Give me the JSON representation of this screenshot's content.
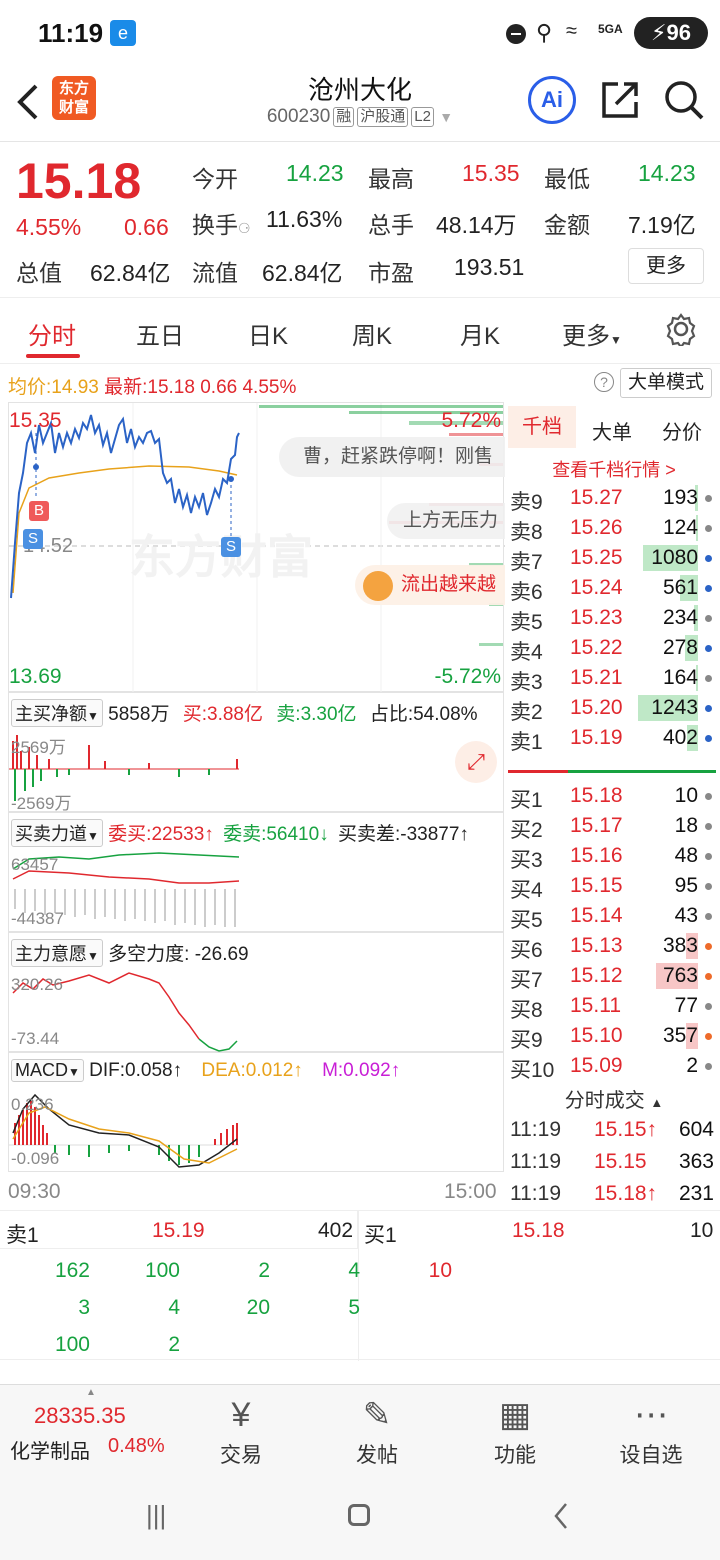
{
  "status": {
    "time": "11:19",
    "battery": "96",
    "network": "5GA"
  },
  "header": {
    "logo": "东方\n财富",
    "name": "沧州大化",
    "code": "600230",
    "tags": [
      "融",
      "沪股通",
      "L2"
    ]
  },
  "quote": {
    "price": "15.18",
    "pct": "4.55%",
    "chg": "0.66",
    "fields": [
      {
        "label": "今开",
        "value": "14.23",
        "c": "green"
      },
      {
        "label": "最高",
        "value": "15.35",
        "c": "red"
      },
      {
        "label": "最低",
        "value": "14.23",
        "c": "green"
      },
      {
        "label": "换手",
        "value": "11.63%",
        "c": "dark"
      },
      {
        "label": "总手",
        "value": "48.14万",
        "c": "dark"
      },
      {
        "label": "金额",
        "value": "7.19亿",
        "c": "dark"
      },
      {
        "label": "总值",
        "value": "62.84亿",
        "c": "dark"
      },
      {
        "label": "流值",
        "value": "62.84亿",
        "c": "dark"
      },
      {
        "label": "市盈",
        "value": "193.51",
        "c": "dark"
      }
    ],
    "more": "更多"
  },
  "tabs": [
    "分时",
    "五日",
    "日K",
    "周K",
    "月K",
    "更多"
  ],
  "avgbar": {
    "avg_label": "均价:",
    "avg": "14.93",
    "last_label": "最新:",
    "last": "15.18",
    "chg": "0.66",
    "pct": "4.55%",
    "mode": "大单模式"
  },
  "chart": {
    "high": "15.35",
    "mid": "14.52",
    "low": "13.69",
    "pct_high": "5.72%",
    "pct_low": "-5.72%",
    "time_start": "09:30",
    "time_end": "15:00",
    "watermark": "东方财富",
    "bubble1": "曹，赶紧跌停啊！刚售",
    "bubble2": "上方无压力",
    "bubble3": "流出越来越",
    "b_mark": "B",
    "s_mark": "S"
  },
  "sub1": {
    "label": "主买净额",
    "net": "5858万",
    "buy_label": "买:",
    "buy": "3.88亿",
    "sell_label": "卖:",
    "sell": "3.30亿",
    "ratio_label": "占比:",
    "ratio": "54.08%",
    "top": "2569万",
    "bot": "-2569万"
  },
  "sub2": {
    "label": "买卖力道",
    "wb_label": "委买:",
    "wb": "22533↑",
    "ws_label": "委卖:",
    "ws": "56410↓",
    "diff_label": "买卖差:",
    "diff": "-33877↑",
    "top": "63457",
    "bot": "-44387"
  },
  "sub3": {
    "label": "主力意愿",
    "force": "多空力度: -26.69",
    "top": "320.26",
    "bot": "-73.44"
  },
  "sub4": {
    "label": "MACD",
    "dif": "DIF:0.058↑",
    "dea": "DEA:0.012↑",
    "m": "M:0.092↑",
    "top": "0.236",
    "bot": "-0.096"
  },
  "book": {
    "tabs": [
      "千档",
      "大单",
      "分价"
    ],
    "link": "查看千档行情 >",
    "asks": [
      {
        "l": "卖9",
        "p": "15.27",
        "v": "193",
        "w": 0.05,
        "dot": "gray"
      },
      {
        "l": "卖8",
        "p": "15.26",
        "v": "124",
        "w": 0.03,
        "dot": "gray"
      },
      {
        "l": "卖7",
        "p": "15.25",
        "v": "1080",
        "w": 0.92,
        "dot": "blue"
      },
      {
        "l": "卖6",
        "p": "15.24",
        "v": "561",
        "w": 0.3,
        "dot": "blue"
      },
      {
        "l": "卖5",
        "p": "15.23",
        "v": "234",
        "w": 0.06,
        "dot": "gray"
      },
      {
        "l": "卖4",
        "p": "15.22",
        "v": "278",
        "w": 0.22,
        "dot": "blue"
      },
      {
        "l": "卖3",
        "p": "15.21",
        "v": "164",
        "w": 0.03,
        "dot": "gray"
      },
      {
        "l": "卖2",
        "p": "15.20",
        "v": "1243",
        "w": 1.0,
        "dot": "blue"
      },
      {
        "l": "卖1",
        "p": "15.19",
        "v": "402",
        "w": 0.18,
        "dot": "blue"
      }
    ],
    "bids": [
      {
        "l": "买1",
        "p": "15.18",
        "v": "10",
        "w": 0.0,
        "dot": "gray"
      },
      {
        "l": "买2",
        "p": "15.17",
        "v": "18",
        "w": 0.0,
        "dot": "gray"
      },
      {
        "l": "买3",
        "p": "15.16",
        "v": "48",
        "w": 0.0,
        "dot": "gray"
      },
      {
        "l": "买4",
        "p": "15.15",
        "v": "95",
        "w": 0.0,
        "dot": "gray"
      },
      {
        "l": "买5",
        "p": "15.14",
        "v": "43",
        "w": 0.0,
        "dot": "gray"
      },
      {
        "l": "买6",
        "p": "15.13",
        "v": "383",
        "w": 0.2,
        "dot": "orange"
      },
      {
        "l": "买7",
        "p": "15.12",
        "v": "763",
        "w": 0.7,
        "dot": "orange"
      },
      {
        "l": "买8",
        "p": "15.11",
        "v": "77",
        "w": 0.0,
        "dot": "gray"
      },
      {
        "l": "买9",
        "p": "15.10",
        "v": "357",
        "w": 0.2,
        "dot": "orange"
      },
      {
        "l": "买10",
        "p": "15.09",
        "v": "2",
        "w": 0.0,
        "dot": "gray"
      }
    ],
    "trades_title": "分时成交",
    "trades": [
      {
        "t": "11:19",
        "p": "15.15↑",
        "v": "604"
      },
      {
        "t": "11:19",
        "p": "15.15",
        "v": "363"
      },
      {
        "t": "11:19",
        "p": "15.18↑",
        "v": "231"
      }
    ]
  },
  "queue": {
    "ask_label": "卖1",
    "ask_price": "15.19",
    "ask_vol": "402",
    "bid_label": "买1",
    "bid_price": "15.18",
    "bid_vol": "10",
    "ask_rows": [
      [
        "162",
        "100",
        "2",
        "4"
      ],
      [
        "3",
        "4",
        "20",
        "5"
      ],
      [
        "100",
        "2",
        "",
        ""
      ]
    ],
    "bid_rows": [
      [
        "10"
      ]
    ]
  },
  "nav": {
    "index_value": "28335.35",
    "index_name": "化学制品",
    "index_pct": "0.48%",
    "items": [
      "交易",
      "发帖",
      "功能",
      "设自选"
    ]
  }
}
